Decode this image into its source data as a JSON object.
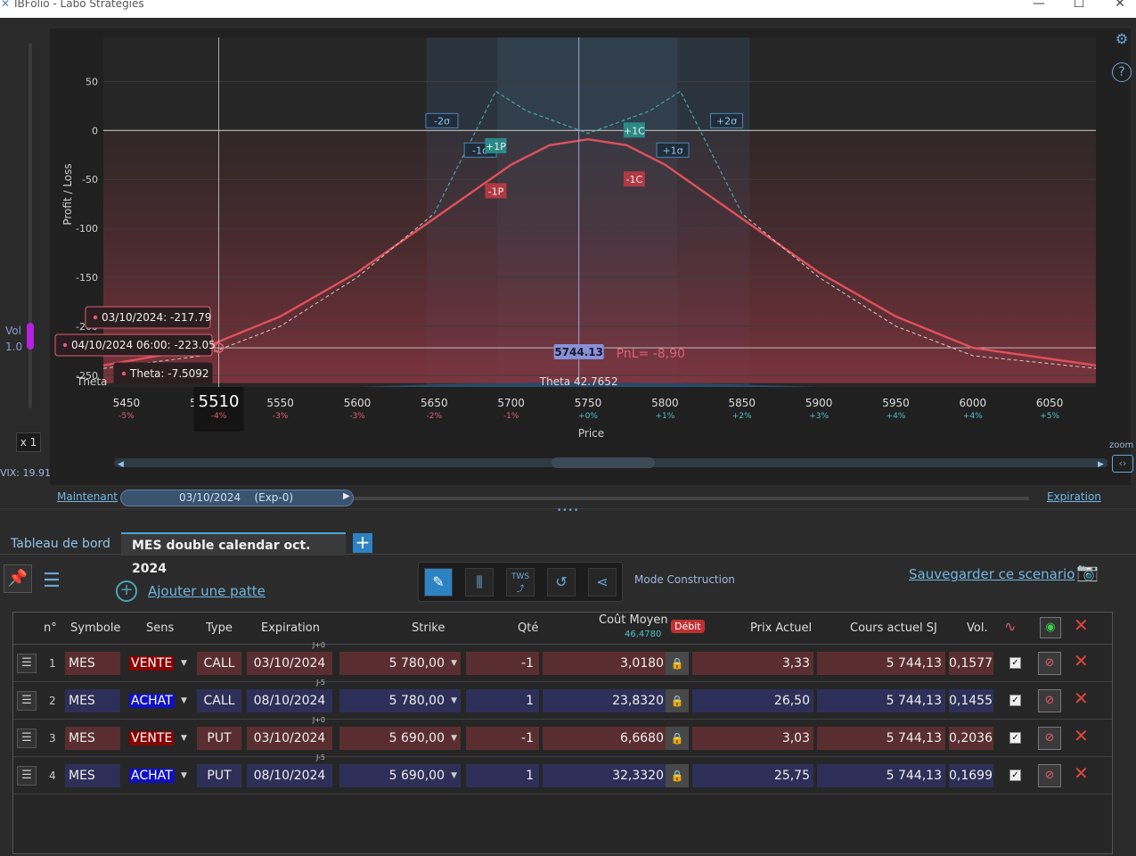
{
  "window": {
    "title": "IBFolio - Labo Stratégies"
  },
  "left": {
    "vol_label": "Vol",
    "vol_value": "1.0",
    "x1": "x 1",
    "vix": "VIX: 19.91"
  },
  "right": {
    "zoom": "zoom"
  },
  "chart_data": {
    "type": "line",
    "title": "",
    "xlabel": "Price",
    "ylabel": "Profit / Loss",
    "x_ticks": [
      {
        "v": 5450,
        "p": "-5%"
      },
      {
        "v": 5500,
        "p": "-4%"
      },
      {
        "v": 5550,
        "p": "-3%"
      },
      {
        "v": 5600,
        "p": "-3%"
      },
      {
        "v": 5650,
        "p": "-2%"
      },
      {
        "v": 5700,
        "p": "-1%"
      },
      {
        "v": 5750,
        "p": "+0%"
      },
      {
        "v": 5800,
        "p": "+1%"
      },
      {
        "v": 5850,
        "p": "+2%"
      },
      {
        "v": 5900,
        "p": "+3%"
      },
      {
        "v": 5950,
        "p": "+4%"
      },
      {
        "v": 6000,
        "p": "+4%"
      },
      {
        "v": 6050,
        "p": "+5%"
      }
    ],
    "y_ticks": [
      50,
      0,
      -50,
      -100,
      -150,
      -200,
      -250
    ],
    "xlim": [
      5435,
      6080
    ],
    "ylim": [
      -262,
      95
    ],
    "grid": true,
    "series": [
      {
        "color": "#e0505a",
        "dash": false,
        "points": [
          [
            5435,
            -240
          ],
          [
            5500,
            -222
          ],
          [
            5550,
            -190
          ],
          [
            5600,
            -145
          ],
          [
            5650,
            -90
          ],
          [
            5700,
            -35
          ],
          [
            5725,
            -15
          ],
          [
            5750,
            -9
          ],
          [
            5775,
            -15
          ],
          [
            5800,
            -35
          ],
          [
            5850,
            -90
          ],
          [
            5900,
            -145
          ],
          [
            5950,
            -190
          ],
          [
            6000,
            -222
          ],
          [
            6080,
            -240
          ]
        ]
      },
      {
        "color": "#cfcfcf",
        "dash": true,
        "points": [
          [
            5435,
            -243
          ],
          [
            5500,
            -230
          ],
          [
            5550,
            -200
          ],
          [
            5600,
            -150
          ],
          [
            5650,
            -85
          ],
          [
            5690,
            40
          ],
          [
            5710,
            20
          ],
          [
            5750,
            -3
          ],
          [
            5790,
            20
          ],
          [
            5810,
            40
          ],
          [
            5850,
            -85
          ],
          [
            5900,
            -150
          ],
          [
            5950,
            -200
          ],
          [
            6000,
            -230
          ],
          [
            6080,
            -243
          ]
        ]
      },
      {
        "color": "#27a6a8",
        "dash": true,
        "points": [
          [
            5650,
            -85
          ],
          [
            5690,
            40
          ],
          [
            5710,
            20
          ],
          [
            5750,
            -3
          ],
          [
            5790,
            20
          ],
          [
            5810,
            40
          ],
          [
            5850,
            -85
          ]
        ]
      }
    ],
    "sigma_labels": [
      "-2σ",
      "+2σ",
      "-1σ",
      "+1σ"
    ],
    "strike_labels": [
      "+1P",
      "-1P",
      "+1C",
      "-1C"
    ],
    "current_price": "5744.13",
    "pnl": "PnL= -8,90",
    "theta_bar": "Theta 42.7652",
    "theta_axis": "Theta",
    "cursor_price": "5510",
    "cursor_pct": "-4%",
    "tooltips": [
      "03/10/2024: -217.79",
      "04/10/2024 06:00: -223.05",
      "Theta: -7.5092"
    ]
  },
  "timeline": {
    "now": "Maintenant",
    "date": "03/10/2024",
    "exp": "(Exp-0)",
    "expiration": "Expiration"
  },
  "tabs": {
    "tab1": "Tableau de bord",
    "tab2": "MES double calendar oct. 2024",
    "add": "+"
  },
  "toolbar": {
    "add_leg": "Ajouter une patte",
    "mode": "Mode Construction",
    "save": "Sauvegarder ce scenario"
  },
  "table": {
    "headers": {
      "n": "n°",
      "symbol": "Symbole",
      "sens": "Sens",
      "type": "Type",
      "expiration": "Expiration",
      "strike": "Strike",
      "qty": "Qté",
      "cost": "Coût Moyen",
      "cost_sub": "46,4780",
      "debit": "Débit",
      "price": "Prix Actuel",
      "spot": "Cours actuel SJ",
      "vol": "Vol."
    },
    "rows": [
      {
        "n": "1",
        "symbol": "MES",
        "sens": "VENTE",
        "type": "CALL",
        "exp": "03/10/2024",
        "dte": "J+0",
        "strike": "5 780,00",
        "qty": "-1",
        "cost": "3,0180",
        "price": "3,33",
        "spot": "5 744,13",
        "vol": "0,1577"
      },
      {
        "n": "2",
        "symbol": "MES",
        "sens": "ACHAT",
        "type": "CALL",
        "exp": "08/10/2024",
        "dte": "J-5",
        "strike": "5 780,00",
        "qty": "1",
        "cost": "23,8320",
        "price": "26,50",
        "spot": "5 744,13",
        "vol": "0,1455"
      },
      {
        "n": "3",
        "symbol": "MES",
        "sens": "VENTE",
        "type": "PUT",
        "exp": "03/10/2024",
        "dte": "J+0",
        "strike": "5 690,00",
        "qty": "-1",
        "cost": "6,6680",
        "price": "3,03",
        "spot": "5 744,13",
        "vol": "0,2036"
      },
      {
        "n": "4",
        "symbol": "MES",
        "sens": "ACHAT",
        "type": "PUT",
        "exp": "08/10/2024",
        "dte": "J-5",
        "strike": "5 690,00",
        "qty": "1",
        "cost": "32,3320",
        "price": "25,75",
        "spot": "5 744,13",
        "vol": "0,1699"
      }
    ]
  }
}
